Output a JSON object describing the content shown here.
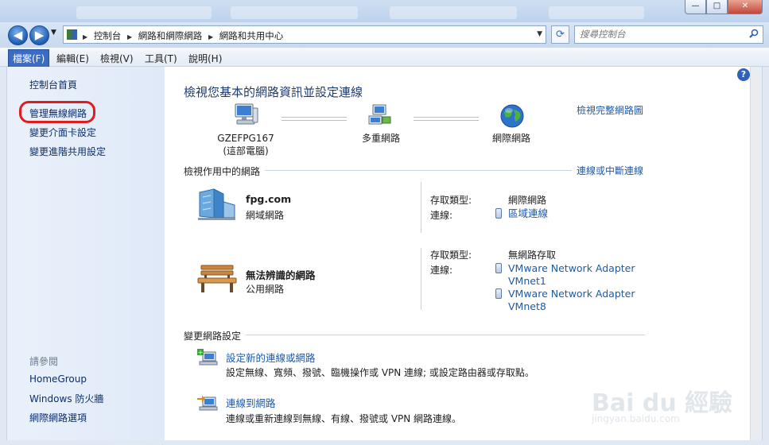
{
  "window": {
    "minimize": "—",
    "maximize": "□",
    "close": "✕"
  },
  "nav": {
    "breadcrumbs": [
      "控制台",
      "網路和網際網路",
      "網路和共用中心"
    ],
    "search_placeholder": "搜尋控制台"
  },
  "menu": [
    "檔案(F)",
    "編輯(E)",
    "檢視(V)",
    "工具(T)",
    "說明(H)"
  ],
  "sidebar": {
    "home": "控制台首頁",
    "items": [
      "管理無線網路",
      "變更介面卡設定",
      "變更進階共用設定"
    ],
    "see_also_title": "請參閱",
    "see_also": [
      "HomeGroup",
      "Windows 防火牆",
      "網際網路選項"
    ]
  },
  "main": {
    "title": "檢視您基本的網路資訊並設定連線",
    "full_map_link": "檢視完整網路圖",
    "map_nodes": [
      {
        "label": "GZEFPG167",
        "sub": "(這部電腦)"
      },
      {
        "label": "多重網路",
        "sub": ""
      },
      {
        "label": "網際網路",
        "sub": ""
      }
    ],
    "active_section_title": "檢視作用中的網路",
    "connect_link": "連線或中斷連線",
    "networks": [
      {
        "name": "fpg.com",
        "category": "網域網路",
        "access_label": "存取類型:",
        "access_value": "網際網路",
        "conn_label": "連線:",
        "connections": [
          "區域連線"
        ]
      },
      {
        "name": "無法辨識的網路",
        "category": "公用網路",
        "access_label": "存取類型:",
        "access_value": "無網路存取",
        "conn_label": "連線:",
        "connections": [
          "VMware Network Adapter VMnet1",
          "VMware Network Adapter VMnet8"
        ]
      }
    ],
    "change_section_title": "變更網路設定",
    "tasks": [
      {
        "link": "設定新的連線或網路",
        "desc": "設定無線、寬頻、撥號、臨機操作或 VPN 連線; 或設定路由器或存取點。"
      },
      {
        "link": "連線到網路",
        "desc": "連線或重新連線到無線、有線、撥號或 VPN 網路連線。"
      }
    ]
  },
  "watermark": {
    "text": "Bai du 經驗",
    "sub": "jingyan.baidu.com"
  }
}
